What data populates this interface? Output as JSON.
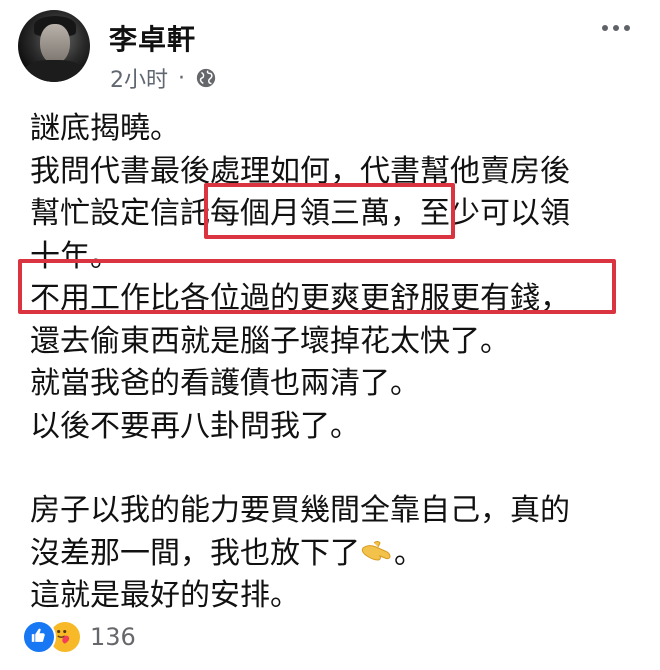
{
  "author": {
    "name": "李卓軒",
    "time": "2小时",
    "separator": "·",
    "privacy_icon": "globe-icon"
  },
  "post": {
    "lines": [
      "謎底揭曉。",
      "我問代書最後處理如何，代書幫他賣房後",
      "幫忙設定信託每個月領三萬，至少可以領",
      "十年。",
      "不用工作比各位過的更爽更舒服更有錢，",
      "還去偷東西就是腦子壞掉花太快了。",
      "就當我爸的看護債也兩清了。",
      "以後不要再八卦問我了。",
      "",
      "房子以我的能力要買幾間全靠自己，真的",
      "沒差那一間，我也放下了",
      "這就是最好的安排。"
    ],
    "line11_suffix": "。",
    "emoji": "pinching-hand-emoji"
  },
  "reactions": {
    "icons": [
      "like-icon",
      "care-icon"
    ],
    "count": "136"
  },
  "colors": {
    "highlight": "#d9343f",
    "like": "#1877f2",
    "care": "#f7b928",
    "meta_text": "#606770"
  }
}
